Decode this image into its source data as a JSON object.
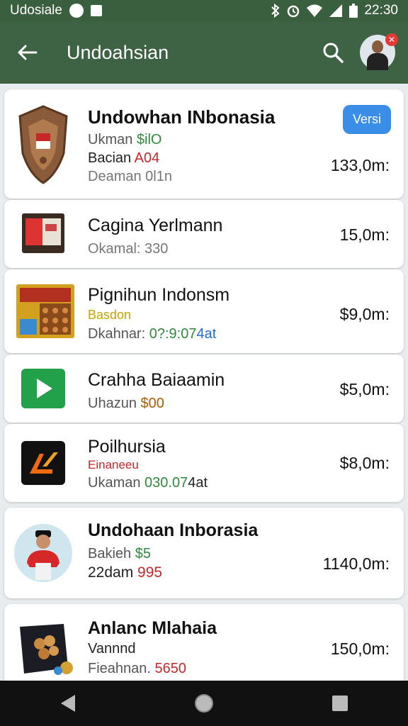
{
  "status_bar": {
    "carrier": "Udosiale",
    "time": "22:30"
  },
  "app_bar": {
    "title": "Undoahsian",
    "notification_count": ""
  },
  "items": [
    {
      "name": "Undowhan INbonasia",
      "lines": [
        {
          "label": "Ukman ",
          "value": "$ilO"
        },
        {
          "label": "Bacian ",
          "value": "A04"
        },
        {
          "label": "Deaman 0l1n",
          "value": ""
        }
      ],
      "price": "133,0m:",
      "badge": "Versi",
      "icon": "emblem-icon"
    },
    {
      "name": "Cagina Yerlmann",
      "lines": [
        {
          "label": "Okamal: 330",
          "value": ""
        }
      ],
      "price": "15,0m:",
      "icon": "tv-screen-icon"
    },
    {
      "name": "Pignihun Indonsm",
      "lines": [
        {
          "label": "Basdon",
          "value": ""
        },
        {
          "label": "Dkahnar: ",
          "value": "0?:9:07",
          "value2": "4at"
        }
      ],
      "price": "$9,0m:",
      "icon": "snack-box-icon"
    },
    {
      "name": "Crahha Baiaamin",
      "lines": [
        {
          "label": "Uhazun ",
          "value": "$00"
        }
      ],
      "price": "$5,0m:",
      "icon": "play-store-icon"
    },
    {
      "name": "Poilhursia",
      "lines": [
        {
          "label": "Einaneeu",
          "value": ""
        },
        {
          "label": "Ukaman ",
          "value": "030.07",
          "value2": "4at"
        }
      ],
      "price": "$8,0m:",
      "icon": "k-logo-icon"
    },
    {
      "name": "Undohaan Inborasia",
      "lines": [
        {
          "label": "Bakieh ",
          "value": "$5"
        },
        {
          "label": "22dam ",
          "value": "995"
        }
      ],
      "price": "1140,0m:",
      "icon": "person-avatar-icon"
    },
    {
      "name": "Anlanc Mlahaia",
      "lines": [
        {
          "label": "Vannnd",
          "value": ""
        },
        {
          "label": "Fieahnan. ",
          "value": "5650"
        }
      ],
      "price": "150,0m:",
      "icon": "cookie-pack-icon"
    }
  ]
}
